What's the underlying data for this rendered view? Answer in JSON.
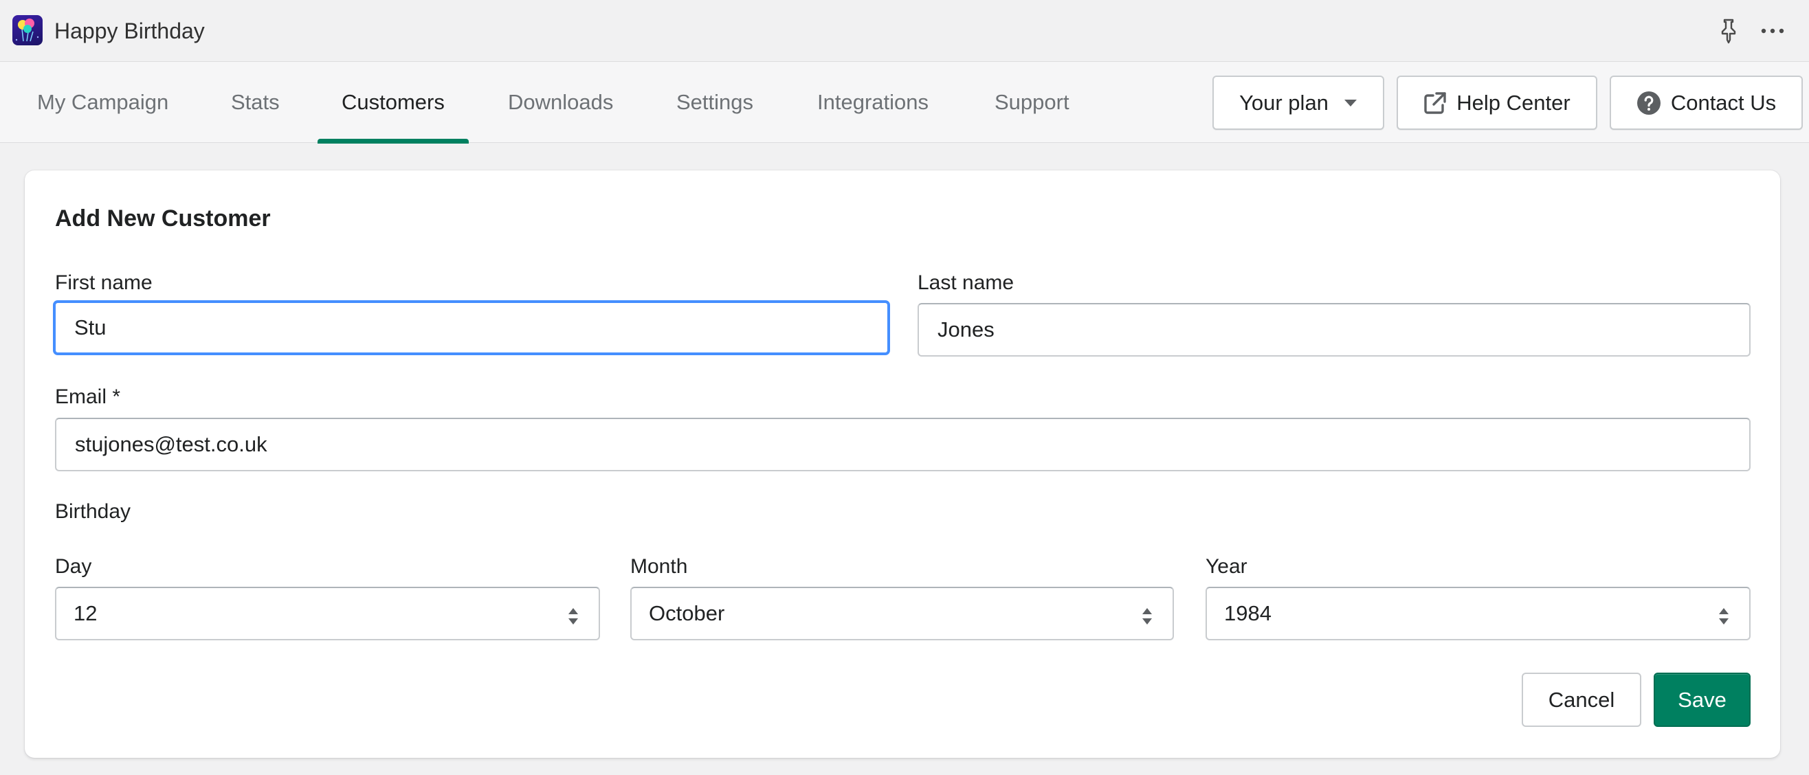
{
  "app": {
    "title": "Happy Birthday"
  },
  "titlebar": {
    "pin_icon": "pin-icon",
    "more_icon": "more-horizontal-icon"
  },
  "nav": {
    "tabs": [
      {
        "label": "My Campaign",
        "active": false
      },
      {
        "label": "Stats",
        "active": false
      },
      {
        "label": "Customers",
        "active": true
      },
      {
        "label": "Downloads",
        "active": false
      },
      {
        "label": "Settings",
        "active": false
      },
      {
        "label": "Integrations",
        "active": false
      },
      {
        "label": "Support",
        "active": false
      }
    ],
    "your_plan_label": "Your plan",
    "help_center_label": "Help Center",
    "contact_us_label": "Contact Us"
  },
  "form": {
    "title": "Add New Customer",
    "first_name": {
      "label": "First name",
      "value": "Stu"
    },
    "last_name": {
      "label": "Last name",
      "value": "Jones"
    },
    "email": {
      "label": "Email *",
      "value": "stujones@test.co.uk"
    },
    "birthday": {
      "label": "Birthday",
      "day": {
        "label": "Day",
        "value": "12"
      },
      "month": {
        "label": "Month",
        "value": "October"
      },
      "year": {
        "label": "Year",
        "value": "1984"
      }
    },
    "cancel_label": "Cancel",
    "save_label": "Save"
  },
  "colors": {
    "accent": "#008060",
    "focus_ring": "#458fff",
    "background": "#f1f1f2"
  }
}
